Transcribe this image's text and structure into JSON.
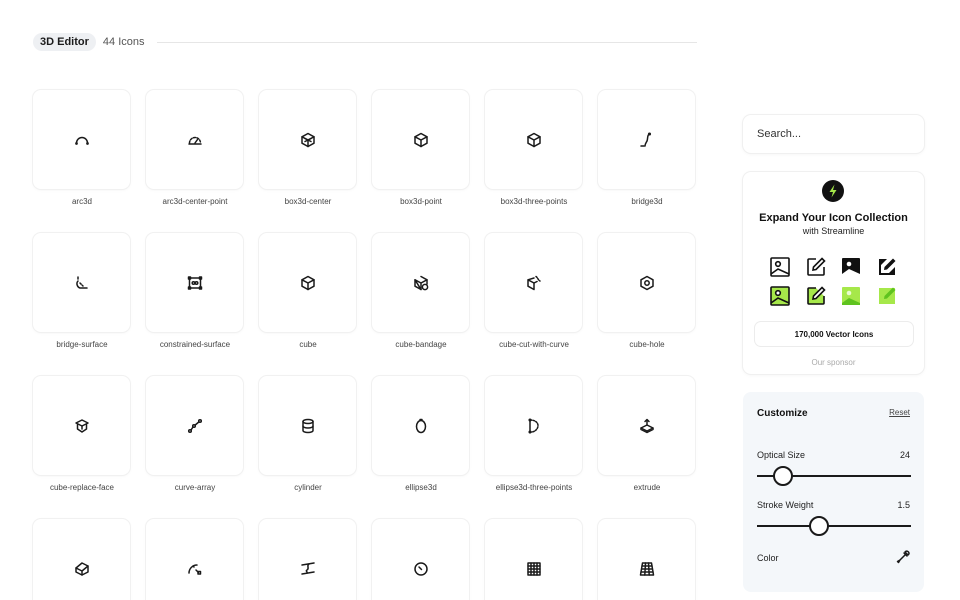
{
  "header": {
    "category": "3D Editor",
    "count": "44 Icons"
  },
  "icons": [
    {
      "label": "arc3d",
      "icon": "arc3d-icon"
    },
    {
      "label": "arc3d-center-point",
      "icon": "arc3d-center-point-icon"
    },
    {
      "label": "box3d-center",
      "icon": "box3d-center-icon"
    },
    {
      "label": "box3d-point",
      "icon": "box3d-point-icon"
    },
    {
      "label": "box3d-three-points",
      "icon": "box3d-three-points-icon"
    },
    {
      "label": "bridge3d",
      "icon": "bridge3d-icon"
    },
    {
      "label": "bridge-surface",
      "icon": "bridge-surface-icon"
    },
    {
      "label": "constrained-surface",
      "icon": "constrained-surface-icon"
    },
    {
      "label": "cube",
      "icon": "cube-icon"
    },
    {
      "label": "cube-bandage",
      "icon": "cube-bandage-icon"
    },
    {
      "label": "cube-cut-with-curve",
      "icon": "cube-cut-with-curve-icon"
    },
    {
      "label": "cube-hole",
      "icon": "cube-hole-icon"
    },
    {
      "label": "cube-replace-face",
      "icon": "cube-replace-face-icon"
    },
    {
      "label": "curve-array",
      "icon": "curve-array-icon"
    },
    {
      "label": "cylinder",
      "icon": "cylinder-icon"
    },
    {
      "label": "ellipse3d",
      "icon": "ellipse3d-icon"
    },
    {
      "label": "ellipse3d-three-points",
      "icon": "ellipse3d-three-points-icon"
    },
    {
      "label": "extrude",
      "icon": "extrude-icon"
    },
    {
      "label": "",
      "icon": "cube-face-icon"
    },
    {
      "label": "",
      "icon": "arc-corner-icon"
    },
    {
      "label": "",
      "icon": "surface-lines-icon"
    },
    {
      "label": "",
      "icon": "circle-point-icon"
    },
    {
      "label": "",
      "icon": "grid-icon"
    },
    {
      "label": "",
      "icon": "perspective-grid-icon"
    }
  ],
  "search": {
    "placeholder": "Search..."
  },
  "promo": {
    "title": "Expand Your Icon Collection",
    "subtitle": "with Streamline",
    "cta": "170,000 Vector Icons",
    "sponsor": "Our sponsor",
    "accent": "#a6e84a"
  },
  "customize": {
    "title": "Customize",
    "reset": "Reset",
    "optical_size_label": "Optical Size",
    "optical_size_value": "24",
    "optical_size_fraction": 0.17,
    "stroke_weight_label": "Stroke Weight",
    "stroke_weight_value": "1.5",
    "stroke_weight_fraction": 0.4,
    "color_label": "Color"
  }
}
